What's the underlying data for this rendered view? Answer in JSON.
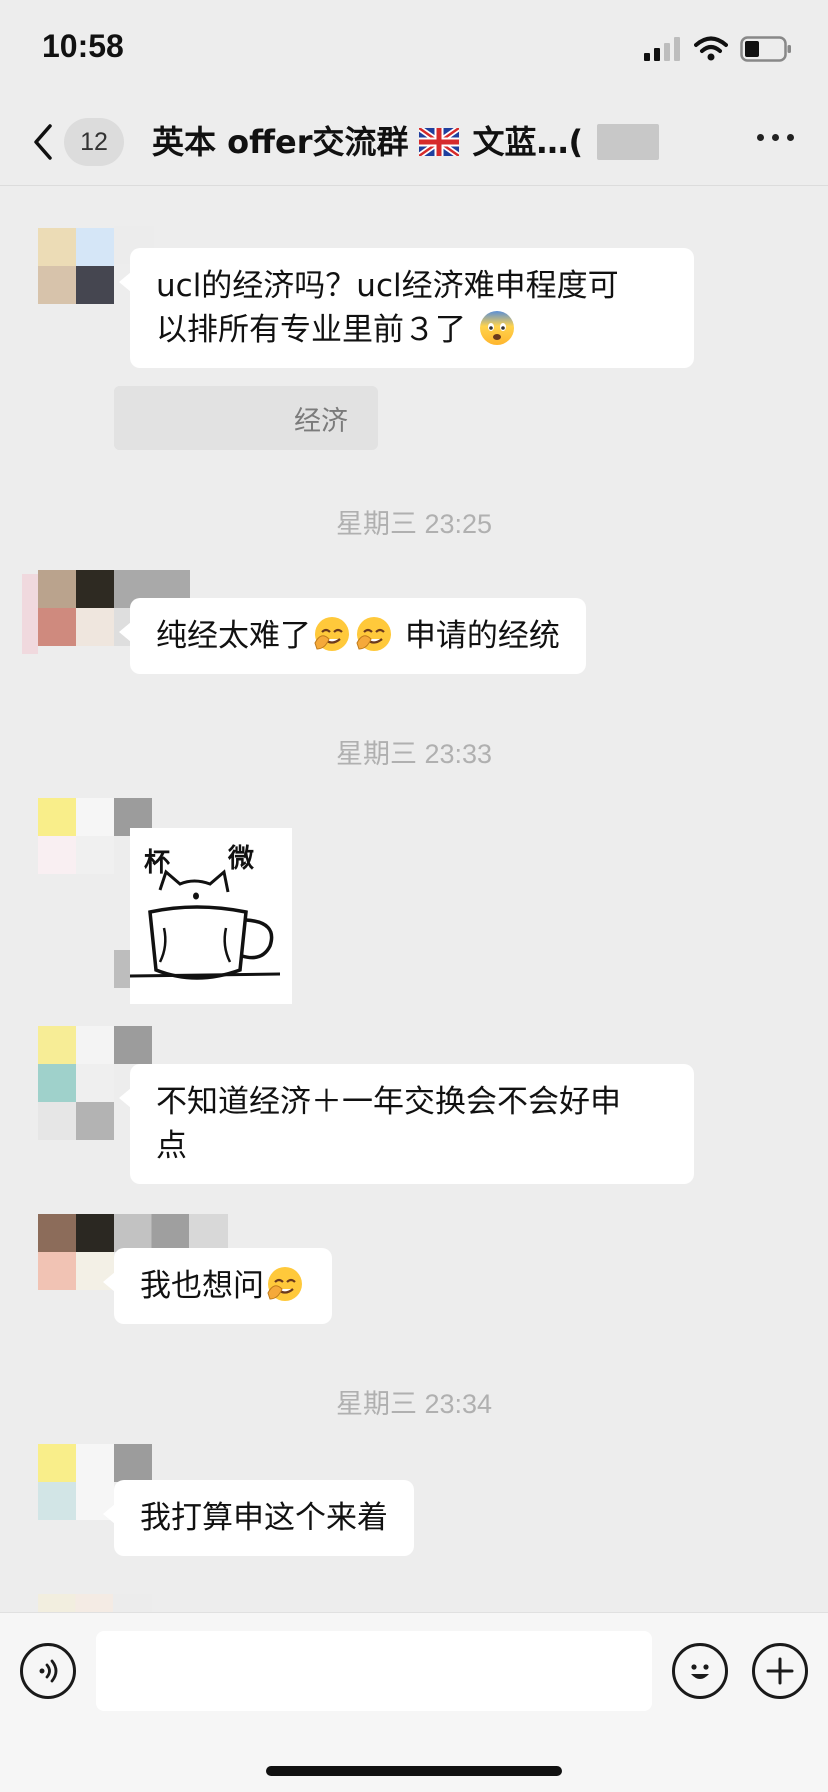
{
  "status_bar": {
    "time": "10:58"
  },
  "header": {
    "unread_count": "12",
    "title": "英本 offer交流群",
    "title_suffix": "文蓝…("
  },
  "messages": [
    {
      "text_line1": "ucl的经济吗？ucl经济难申程度可",
      "text_line2": "以排所有专业里前３了",
      "emoji": "fearful-face"
    },
    {
      "quote_text": "经济"
    },
    {
      "timestamp": "星期三 23:25"
    },
    {
      "text_before": "纯经太难了",
      "text_after": " 申请的经统",
      "emoji": "facepalm-face"
    },
    {
      "timestamp": "星期三 23:33"
    },
    {
      "sticker_text_left": "杯",
      "sticker_text_right": "微"
    },
    {
      "text_line1": "不知道经济＋一年交换会不会好申",
      "text_line2": "点"
    },
    {
      "text": "我也想问",
      "emoji": "facepalm-face"
    },
    {
      "timestamp": "星期三 23:34"
    },
    {
      "text": "我打算申这个来着"
    }
  ],
  "input_bar": {
    "placeholder": ""
  },
  "colors": {
    "background": "#ededed",
    "bubble": "#ffffff",
    "timestamp": "#b0b0b0"
  }
}
